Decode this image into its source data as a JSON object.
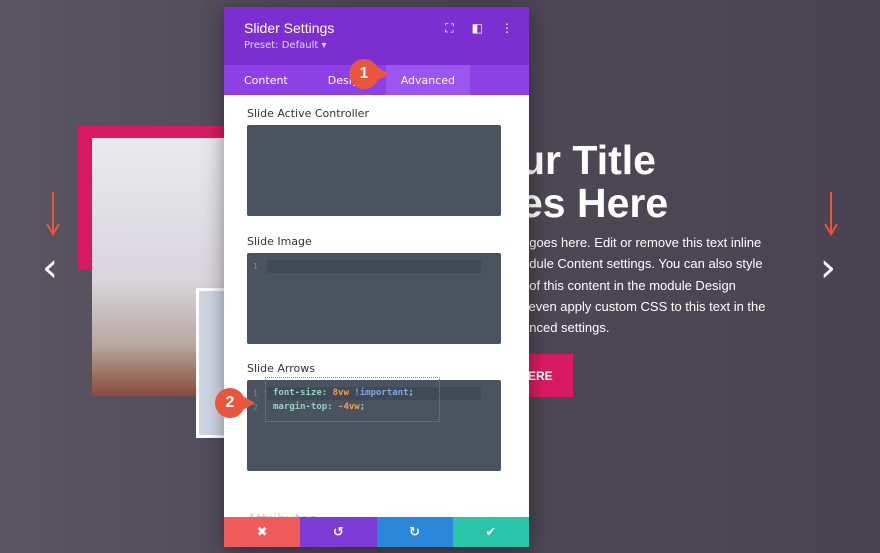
{
  "hero": {
    "title_line1": "ur Title",
    "title_line2": "es Here",
    "paragraph": [
      "t goes here. Edit or remove this text inline",
      "odule Content settings. You can also style",
      "t of this content in the module Design",
      "l even apply custom CSS to this text in the",
      "anced settings."
    ],
    "button": "ERE",
    "prev_icon": "‹",
    "next_icon": "›"
  },
  "panel": {
    "title": "Slider Settings",
    "preset": "Preset: Default ▾",
    "tabs": [
      "Content",
      "Design",
      "Advanced"
    ],
    "fields": [
      {
        "label": "Slide Active Controller"
      },
      {
        "label": "Slide Image",
        "line": "1"
      },
      {
        "label": "Slide Arrows"
      }
    ],
    "code": {
      "l1": "1",
      "l2": "2",
      "prop1": "font-size: ",
      "val1": "8vw ",
      "imp": "!important",
      "semi1": ";",
      "prop2": "margin-top: ",
      "val2": "-4vw",
      "semi2": ";"
    },
    "attributes": "Attributes",
    "footer": {
      "cancel": "✖",
      "undo": "↺",
      "redo": "↻",
      "save": "✔"
    }
  },
  "badges": [
    "1",
    "2"
  ],
  "colors": {
    "header": "#7b2fd1",
    "tabs": "#8d40e6",
    "cancel": "#ef5b5b",
    "undo": "#7d3bd6",
    "redo": "#2b87da",
    "save": "#29c4a9",
    "badge": "#e9553d",
    "accent": "#d81b60"
  }
}
